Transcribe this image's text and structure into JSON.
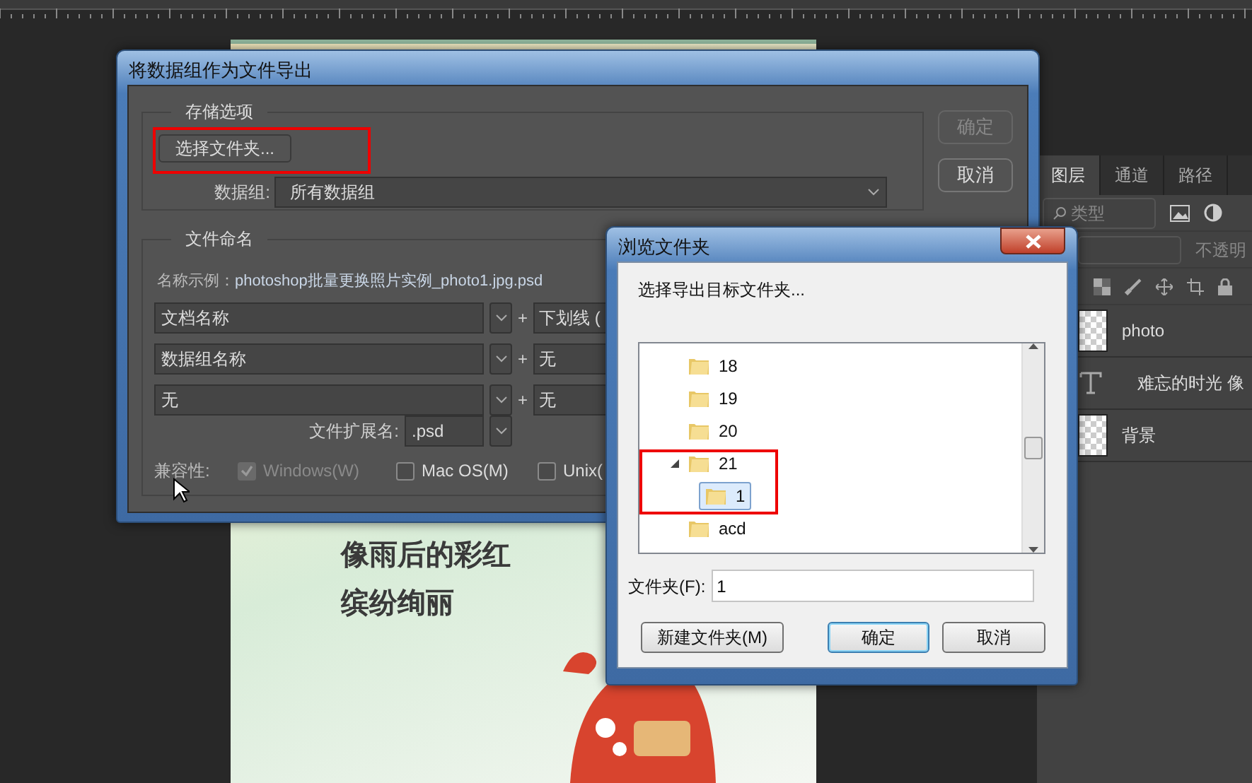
{
  "canvas": {
    "lines": [
      "像雨后的彩红",
      "缤纷绚丽"
    ]
  },
  "layers_panel": {
    "tabs": [
      {
        "label": "图层",
        "selected": true
      },
      {
        "label": "通道",
        "selected": false
      },
      {
        "label": "路径",
        "selected": false
      }
    ],
    "filter_value": "类型",
    "opacity_label": "不透明",
    "layers": [
      {
        "kind": "image",
        "name": "photo"
      },
      {
        "kind": "text",
        "name": "难忘的时光 像"
      },
      {
        "kind": "image",
        "name": "背景"
      }
    ]
  },
  "export_dialog": {
    "title": "将数据组作为文件导出",
    "storage": {
      "legend": "存储选项",
      "choose_button": "选择文件夹...",
      "data_set_label": "数据组:",
      "data_set_value": "所有数据组"
    },
    "naming": {
      "legend": "文件命名",
      "example_label": "名称示例：",
      "example_value": "photoshop批量更换照片实例_photo1.jpg.psd",
      "rows": [
        {
          "value": "文档名称",
          "joiner": "+",
          "suffix": "下划线 ("
        },
        {
          "value": "数据组名称",
          "joiner": "+",
          "suffix": "无"
        },
        {
          "value": "无",
          "joiner": "+",
          "suffix": "无"
        }
      ],
      "extension_label": "文件扩展名:",
      "extension_value": ".psd",
      "compatibility_label": "兼容性:",
      "options": [
        {
          "label": "Windows(W)",
          "checked": true,
          "disabled": true
        },
        {
          "label": "Mac OS(M)",
          "checked": false,
          "disabled": false
        },
        {
          "label": "Unix(",
          "checked": false,
          "disabled": false
        }
      ]
    },
    "buttons": [
      {
        "label": "确定",
        "disabled": true
      },
      {
        "label": "取消",
        "disabled": false
      }
    ]
  },
  "browse_dialog": {
    "title": "浏览文件夹",
    "prompt": "选择导出目标文件夹...",
    "tree": [
      {
        "label": "18",
        "expanded": false,
        "selected": false
      },
      {
        "label": "19",
        "expanded": false,
        "selected": false
      },
      {
        "label": "20",
        "expanded": false,
        "selected": false
      },
      {
        "label": "21",
        "expanded": true,
        "selected": false,
        "children": [
          {
            "label": "1",
            "expanded": false,
            "selected": true
          }
        ]
      },
      {
        "label": "acd",
        "expanded": false,
        "selected": false
      }
    ],
    "folder_label": "文件夹(F):",
    "folder_value": "1",
    "buttons": [
      {
        "label": "新建文件夹(M)",
        "default": false
      },
      {
        "label": "确定",
        "default": true
      },
      {
        "label": "取消",
        "default": false
      }
    ]
  }
}
